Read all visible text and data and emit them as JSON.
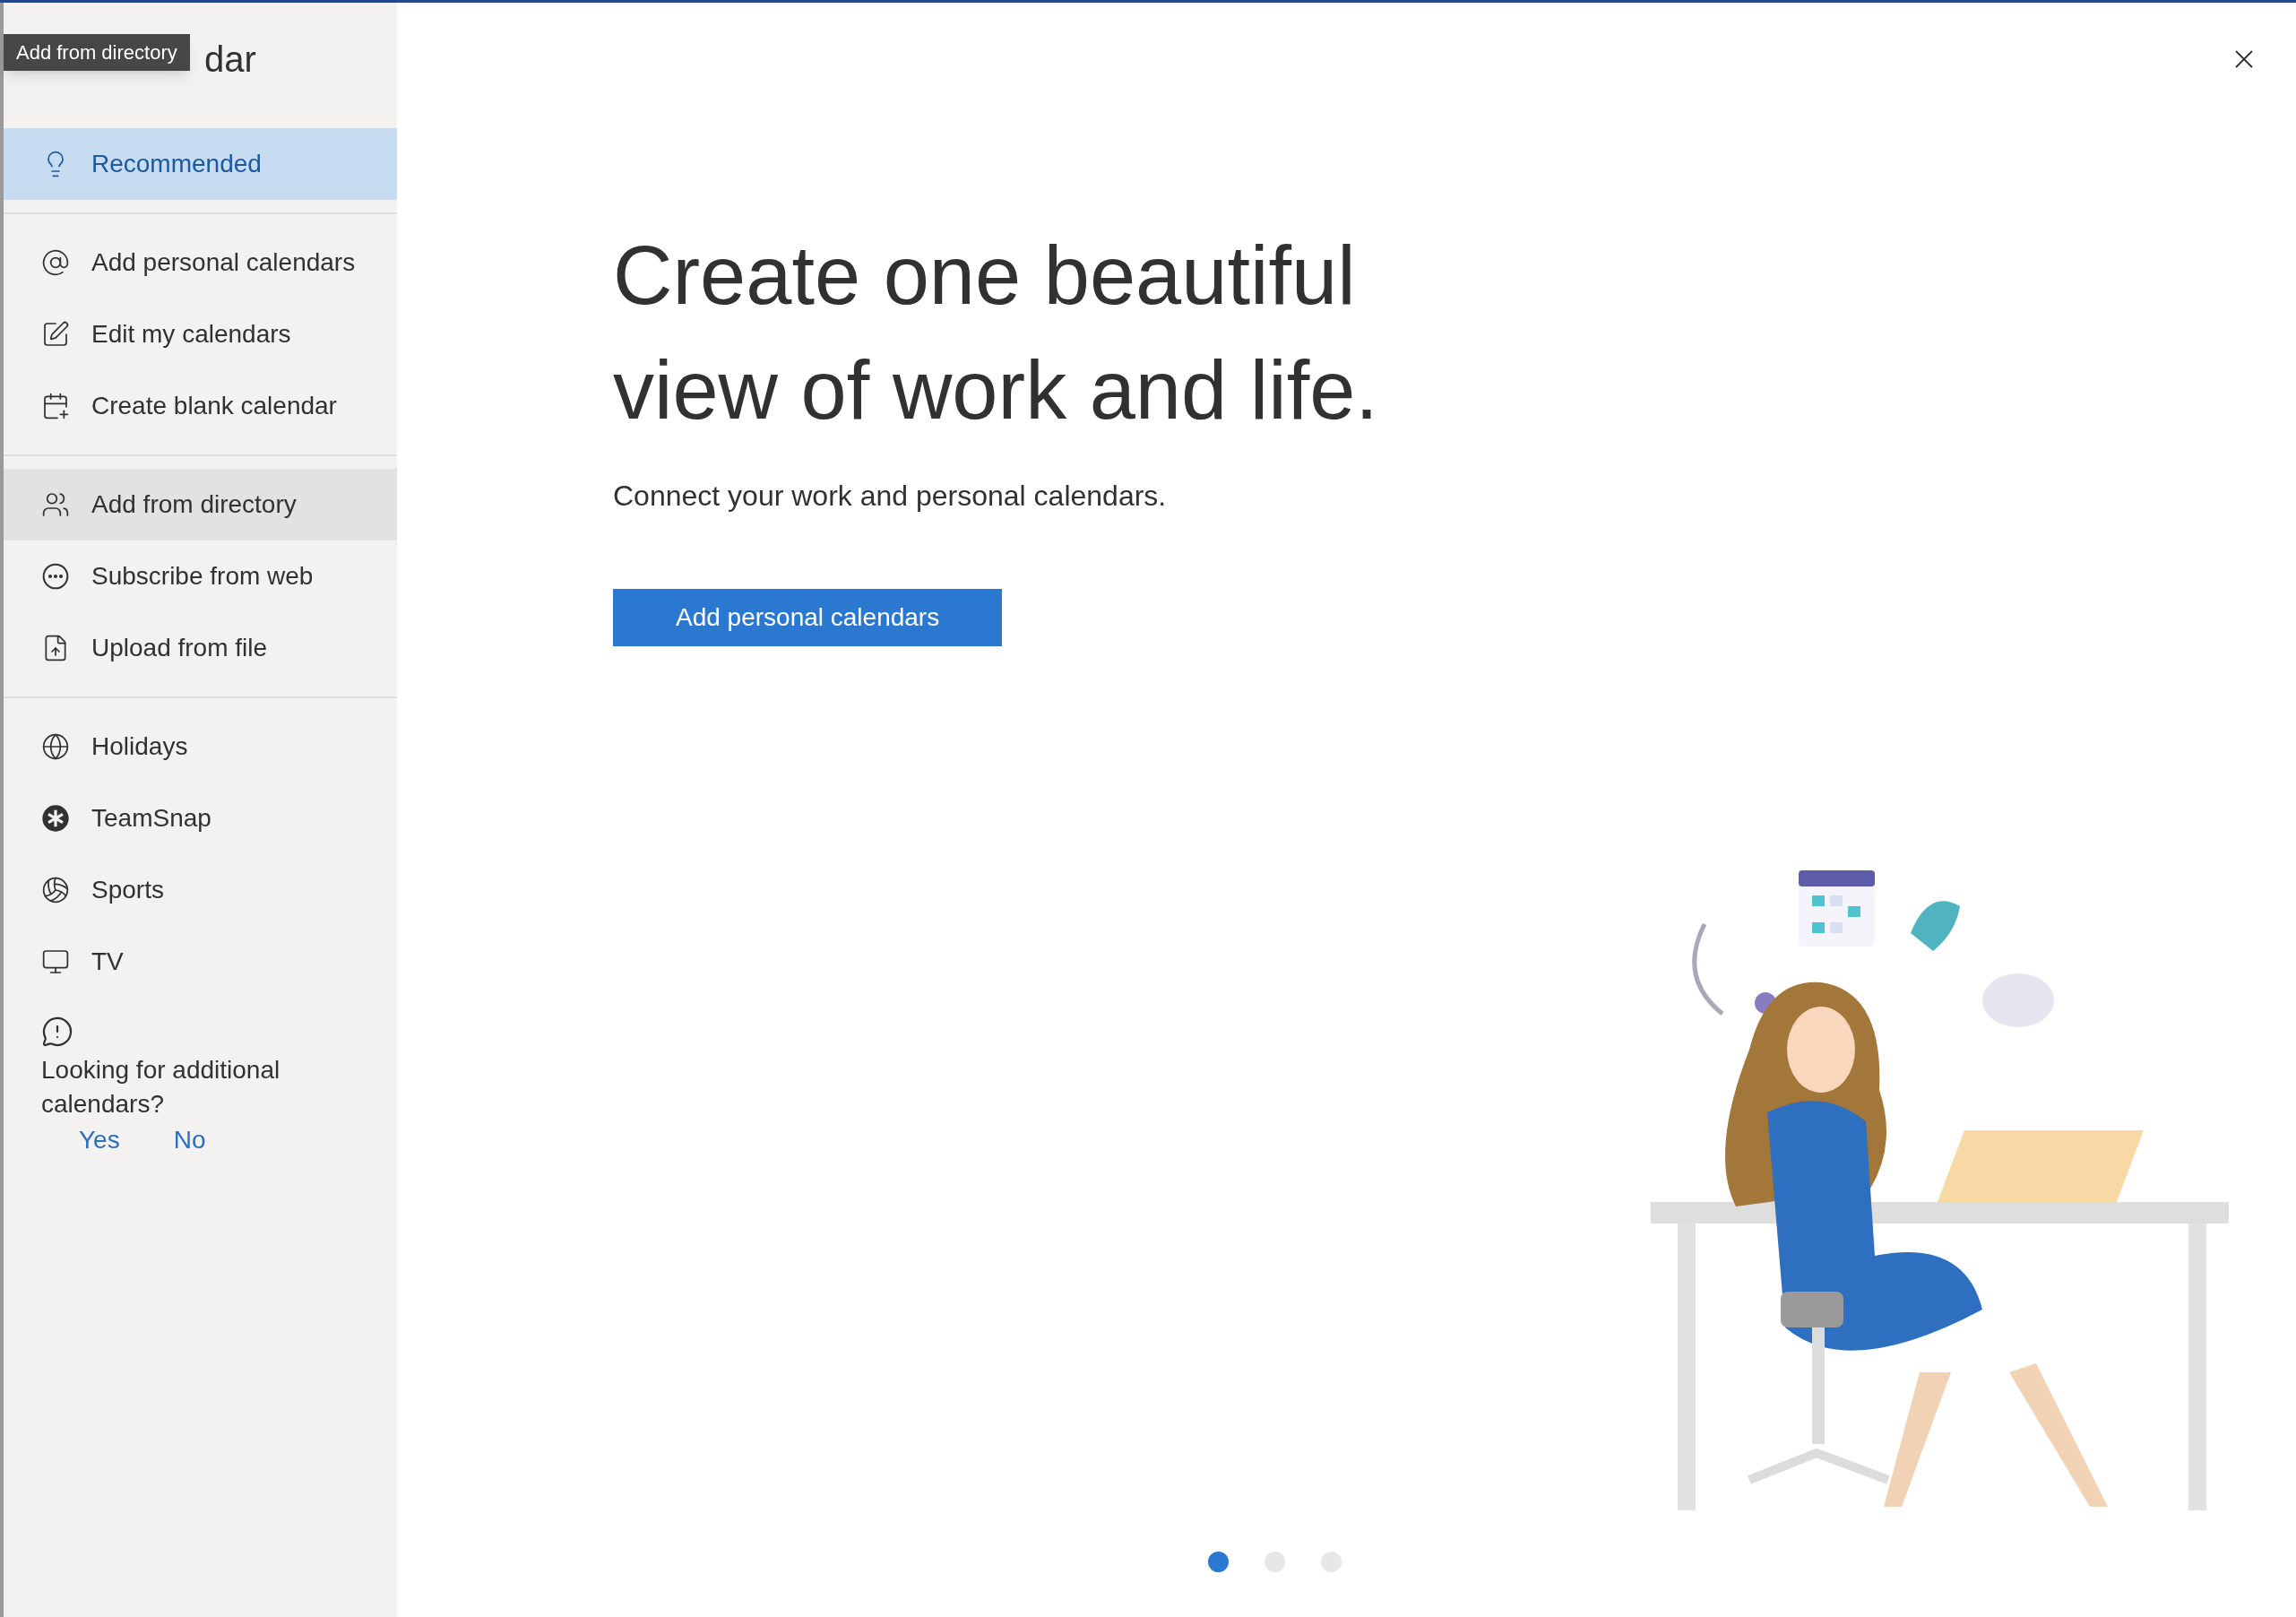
{
  "dialog": {
    "title": "dar",
    "tooltip": "Add from directory"
  },
  "sidebar": {
    "sections": [
      [
        {
          "label": "Recommended",
          "selected": true,
          "hovered": false
        }
      ],
      [
        {
          "label": "Add personal calendars",
          "selected": false,
          "hovered": false
        },
        {
          "label": "Edit my calendars",
          "selected": false,
          "hovered": false
        },
        {
          "label": "Create blank calendar",
          "selected": false,
          "hovered": false
        }
      ],
      [
        {
          "label": "Add from directory",
          "selected": false,
          "hovered": true
        },
        {
          "label": "Subscribe from web",
          "selected": false,
          "hovered": false
        },
        {
          "label": "Upload from file",
          "selected": false,
          "hovered": false
        }
      ],
      [
        {
          "label": "Holidays",
          "selected": false,
          "hovered": false
        },
        {
          "label": "TeamSnap",
          "selected": false,
          "hovered": false
        },
        {
          "label": "Sports",
          "selected": false,
          "hovered": false
        },
        {
          "label": "TV",
          "selected": false,
          "hovered": false
        }
      ]
    ],
    "feedback": {
      "question": "Looking for additional calendars?",
      "yes": "Yes",
      "no": "No"
    }
  },
  "main": {
    "heading": "Create one beautiful view of work and life.",
    "subtitle": "Connect your work and personal calendars.",
    "button": "Add personal calendars",
    "pages": [
      {
        "selected": true
      },
      {
        "selected": false
      },
      {
        "selected": false
      }
    ]
  }
}
